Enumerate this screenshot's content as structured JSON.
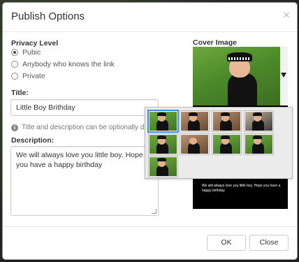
{
  "dialog": {
    "title": "Publish Options",
    "close_glyph": "×"
  },
  "privacy": {
    "label": "Privacy Level",
    "options": [
      "Pubic",
      "Anybody who knows the link",
      "Private"
    ],
    "selected_index": 0
  },
  "title_field": {
    "label": "Title:",
    "value": "Little Boy Brithday"
  },
  "info": {
    "icon": "info-icon",
    "text": "Title and description can be optionally displ"
  },
  "description": {
    "label": "Description:",
    "value": "We will always love you little boy. Hope you have a happy birthday"
  },
  "cover": {
    "label": "Cover Image",
    "caption": "We will always love you little boy. Hope you have a happy birthday",
    "dropdown_icon": "caret-down-icon"
  },
  "thumbnails": {
    "count": 9,
    "selected_index": 0
  },
  "footer": {
    "ok_label": "OK",
    "close_label": "Close"
  },
  "colors": {
    "selected_outline": "#3a8ee6",
    "dialog_bg": "#ffffff"
  }
}
